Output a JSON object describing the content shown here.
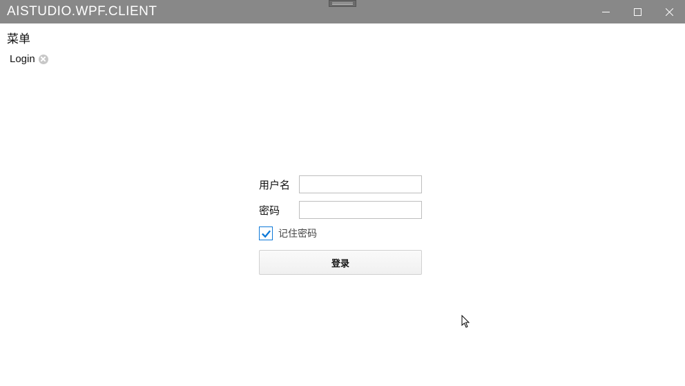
{
  "window": {
    "title": "AISTUDIO.WPF.CLIENT"
  },
  "menu": {
    "label": "菜单"
  },
  "tabs": [
    {
      "label": "Login"
    }
  ],
  "login": {
    "username_label": "用户名",
    "username_value": "",
    "password_label": "密码",
    "password_value": "",
    "remember_label": "记住密码",
    "remember_checked": true,
    "submit_label": "登录"
  }
}
